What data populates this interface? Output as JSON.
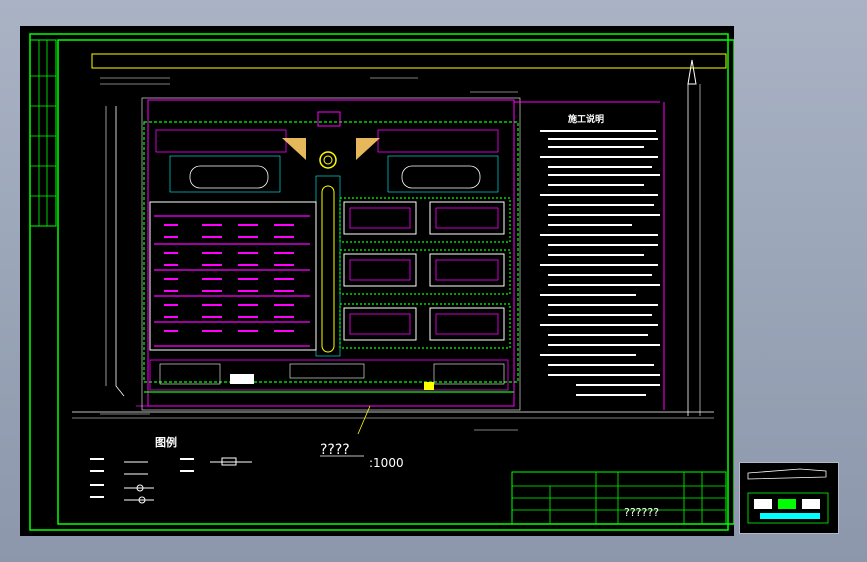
{
  "drawing": {
    "legend_title": "图例",
    "scale_label": "????",
    "scale_ratio": ":1000",
    "notes_title": "施工说明",
    "titleblock_name": "??????",
    "colors": {
      "background": "#000000",
      "frame": "#00ff00",
      "road": "#ffff00",
      "building": "#ff00ff",
      "pipe": "#00ffff",
      "text": "#ffffff",
      "viewport": "#9aa5b8"
    }
  },
  "thumbnail": {
    "name": "layout-thumbnail"
  }
}
